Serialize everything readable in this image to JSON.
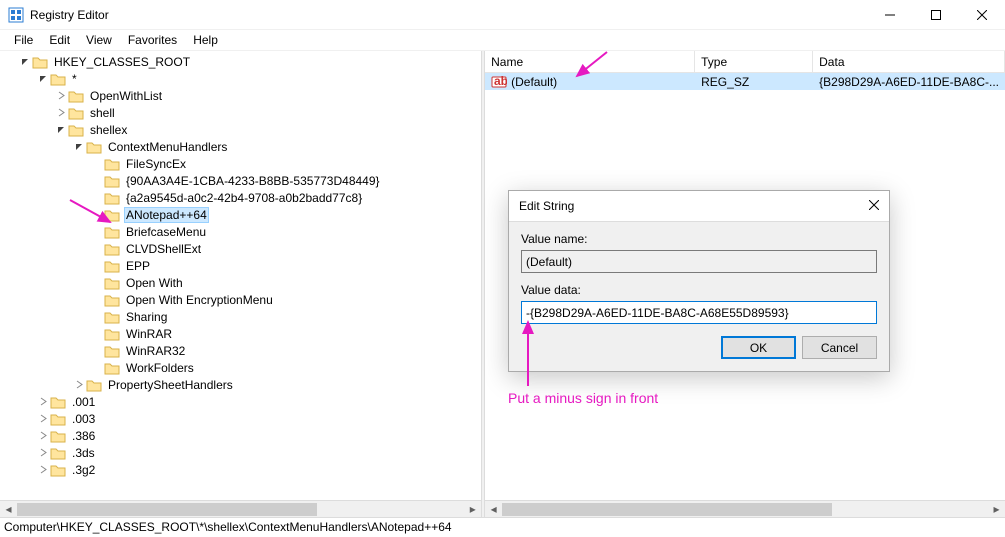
{
  "window": {
    "title": "Registry Editor"
  },
  "menu": [
    "File",
    "Edit",
    "View",
    "Favorites",
    "Help"
  ],
  "tree": {
    "root": "HKEY_CLASSES_ROOT",
    "star": "*",
    "openwith": "OpenWithList",
    "shell": "shell",
    "shellex": "shellex",
    "ctxmenu": "ContextMenuHandlers",
    "children": [
      "FileSyncEx",
      "{90AA3A4E-1CBA-4233-B8BB-535773D48449}",
      "{a2a9545d-a0c2-42b4-9708-a0b2badd77c8}",
      "ANotepad++64",
      "BriefcaseMenu",
      "CLVDShellExt",
      "EPP",
      "Open With",
      "Open With EncryptionMenu",
      "Sharing",
      "WinRAR",
      "WinRAR32",
      "WorkFolders"
    ],
    "psh": "PropertySheetHandlers",
    "siblings": [
      ".001",
      ".003",
      ".386",
      ".3ds",
      ".3g2"
    ]
  },
  "list": {
    "cols": {
      "name": "Name",
      "type": "Type",
      "data": "Data"
    },
    "row": {
      "name": "(Default)",
      "type": "REG_SZ",
      "data": "{B298D29A-A6ED-11DE-BA8C-..."
    }
  },
  "dialog": {
    "title": "Edit String",
    "valname_label": "Value name:",
    "valname": "(Default)",
    "valdata_label": "Value data:",
    "valdata": "-{B298D29A-A6ED-11DE-BA8C-A68E55D89593}",
    "ok": "OK",
    "cancel": "Cancel"
  },
  "status": "Computer\\HKEY_CLASSES_ROOT\\*\\shellex\\ContextMenuHandlers\\ANotepad++64",
  "annotation": "Put a minus sign in front"
}
